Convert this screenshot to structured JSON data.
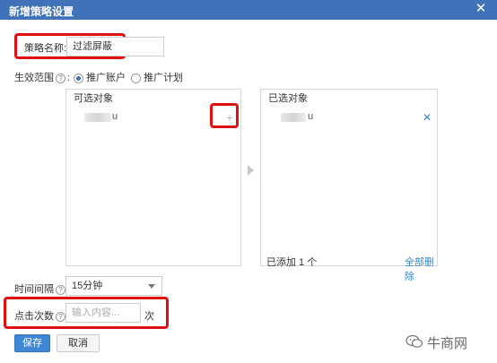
{
  "dialog": {
    "title": "新增策略设置",
    "close_glyph": "✕"
  },
  "form": {
    "name_label": "策略名称:",
    "name_value": "过滤屏蔽",
    "scope_label": "生效范围",
    "scope_colon": ":",
    "scope_options": [
      {
        "label": "推广账户",
        "selected": true
      },
      {
        "label": "推广计划",
        "selected": false
      }
    ],
    "help_glyph": "?",
    "interval_label": "时间间隔",
    "interval_colon": ":",
    "interval_value": "15分钟",
    "clicks_label": "点击次数",
    "clicks_colon": ":",
    "clicks_placeholder": "输入内容...",
    "clicks_unit": "次"
  },
  "available": {
    "title": "可选对象",
    "items": [
      {
        "text": "u"
      }
    ],
    "add_glyph": "+"
  },
  "selected": {
    "title": "已选对象",
    "items": [
      {
        "text": "u"
      }
    ],
    "remove_glyph": "✕",
    "added_count_text": "已添加 1 个",
    "remove_all_label": "全部删除"
  },
  "buttons": {
    "save": "保存",
    "cancel": "取消"
  },
  "watermark": {
    "text": "牛商网",
    "icon": "wechat-icon"
  },
  "colors": {
    "titlebar": "#3f72b8",
    "highlight": "#e01010",
    "primary": "#3f86d6",
    "link": "#2e88d6"
  }
}
